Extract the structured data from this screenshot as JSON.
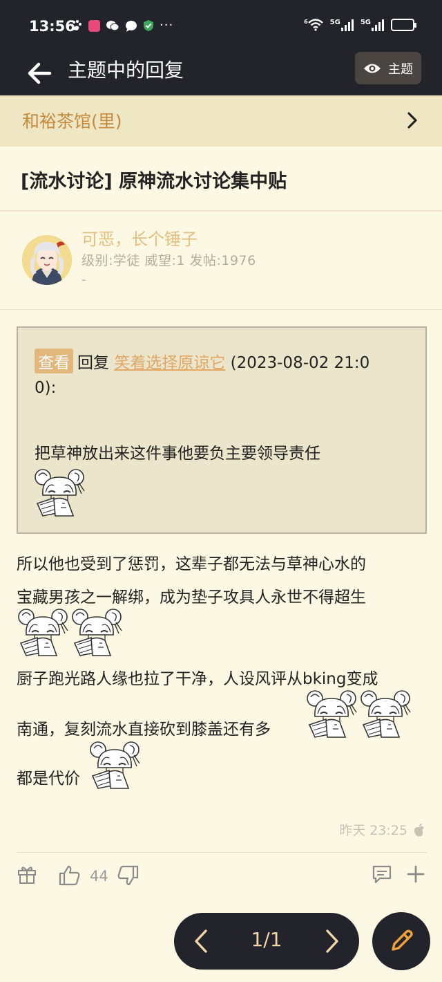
{
  "status": {
    "time": "13:56",
    "dots": "···",
    "net1": "5G",
    "net2": "5G",
    "wifi_sup": "6"
  },
  "toolbar": {
    "title": "主题中的回复",
    "topic_label": "主题"
  },
  "forum": {
    "name": "和裕茶馆(里)"
  },
  "thread": {
    "title": "[流水讨论] 原神流水讨论集中贴"
  },
  "user": {
    "name": "可恶，长个锤子",
    "meta": "级别:学徒 威望:1 发帖:1976",
    "extra": "-"
  },
  "quote": {
    "badge": "查看",
    "reply_word": "回复",
    "quoted_user": "笑着选择原谅它",
    "date_part1": "(2023-08-02 21:0",
    "date_part2": "0):",
    "text": "把草神放出来这件事他要负主要领导责任"
  },
  "body": {
    "line1": "所以他也受到了惩罚，这辈子都无法与草神心水的",
    "line2": "宝藏男孩之一解绑，成为垫子攻具人永世不得超生",
    "line3": "厨子跑光路人缘也拉了干净，人设风评从bking变成",
    "line4": "南通，复刻流水直接砍到膝盖还有多",
    "line5": "都是代价"
  },
  "post": {
    "time": "昨天 23:25"
  },
  "actions": {
    "likes": "44"
  },
  "pager": {
    "label": "1/1"
  },
  "colors": {
    "dark": "#23232b",
    "cream": "#fdf8e4",
    "accent": "#c48a3d",
    "link": "#e2a866"
  }
}
